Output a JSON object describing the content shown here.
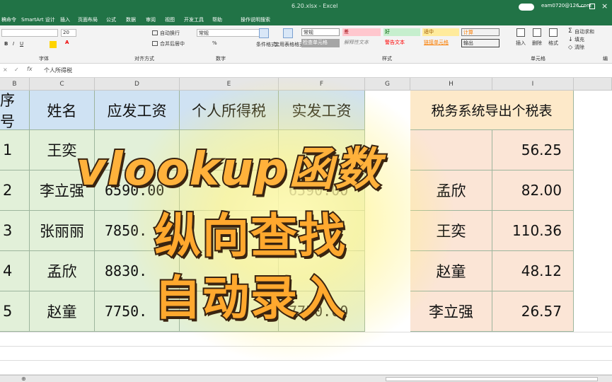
{
  "window": {
    "file_title": "6.20.xlsx - Excel",
    "account": "eam0720@126.com"
  },
  "menu": [
    "稿命令",
    "SmartArt 设计",
    "插入",
    "页面布局",
    "公式",
    "数据",
    "审阅",
    "视图",
    "开发工具",
    "帮助",
    "操作说明搜索"
  ],
  "ribbon": {
    "font_name": "",
    "font_size": "20",
    "wrap_text": "自动换行",
    "merge_center": "合并后居中",
    "number_format": "常规",
    "cond_format": "条件格式",
    "table_format": "套用表格格式",
    "styles": [
      "常规",
      "差",
      "好",
      "适中",
      "计算",
      "检查单元格",
      "解释性文本",
      "警告文本",
      "链接单元格",
      "输出"
    ],
    "insert": "插入",
    "delete": "删除",
    "format": "格式",
    "autosum": "自动求和",
    "fill": "填充",
    "clear": "清除",
    "group_font": "字体",
    "group_align": "对齐方式",
    "group_number": "数字",
    "group_styles": "样式",
    "group_cells": "单元格",
    "group_edit": "编"
  },
  "formula_bar": {
    "content": "个人所得税"
  },
  "columns": [
    "B",
    "C",
    "D",
    "E",
    "F",
    "G",
    "H",
    "I"
  ],
  "table_header": [
    "序号",
    "姓名",
    "应发工资",
    "个人所得税",
    "实发工资"
  ],
  "rows": [
    {
      "no": "1",
      "name": "王奕",
      "gross": "",
      "net": ""
    },
    {
      "no": "2",
      "name": "李立强",
      "gross": "6590.00",
      "net": "6590.00"
    },
    {
      "no": "3",
      "name": "张丽丽",
      "gross": "7850.",
      "net": ""
    },
    {
      "no": "4",
      "name": "孟欣",
      "gross": "8830.",
      "net": ""
    },
    {
      "no": "5",
      "name": "赵童",
      "gross": "7750.",
      "net": "7750.00"
    }
  ],
  "tax_table": {
    "title": "税务系统导出个税表",
    "rows": [
      {
        "name": "",
        "tax": "56.25"
      },
      {
        "name": "孟欣",
        "tax": "82.00"
      },
      {
        "name": "王奕",
        "tax": "110.36"
      },
      {
        "name": "赵童",
        "tax": "48.12"
      },
      {
        "name": "李立强",
        "tax": "26.57"
      }
    ]
  },
  "overlay": {
    "line1": "vlookup函数",
    "line2": "纵向查找",
    "line3": "自动录入"
  },
  "colors": {
    "excel_green": "#217346",
    "header_blue": "#cfe2f3",
    "body_green": "#e2f0d9",
    "tax_pink": "#fbe5d6",
    "overlay_orange": "#ffb13b"
  }
}
